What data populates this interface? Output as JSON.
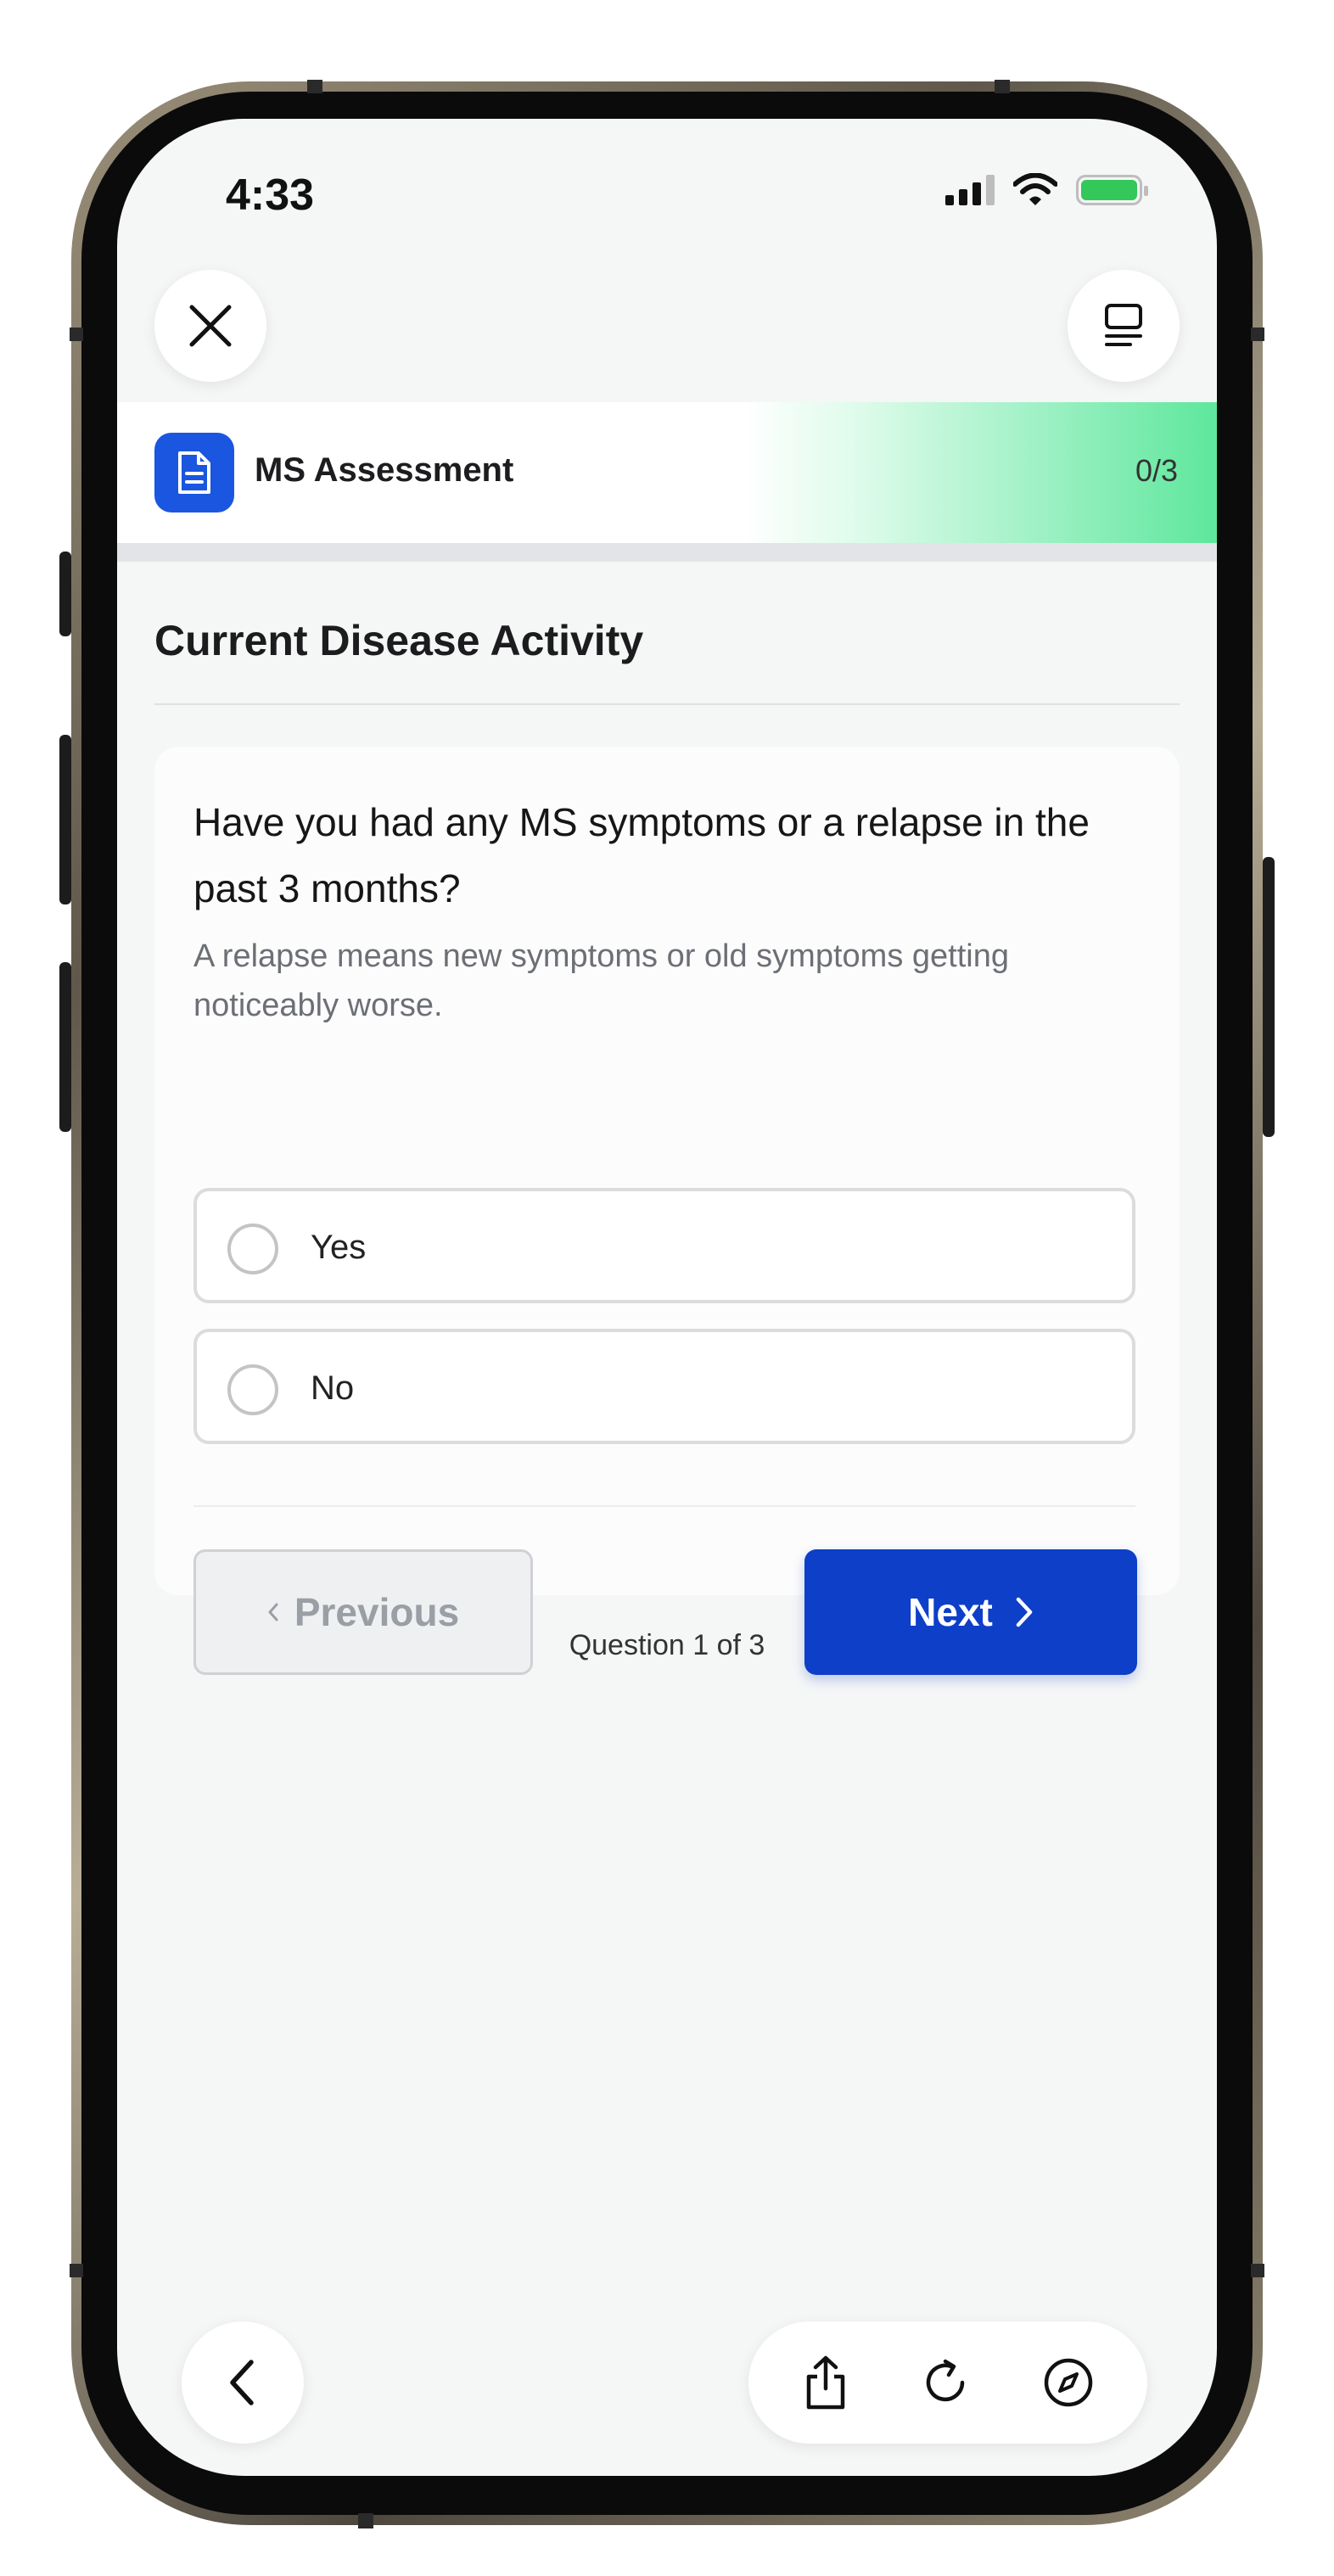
{
  "status_bar": {
    "time": "4:33"
  },
  "top_bar": {
    "close_icon": "close-icon",
    "menu_icon": "menu-icon"
  },
  "header": {
    "icon": "document-icon",
    "title": "MS Assessment",
    "count": "0/3",
    "accent_color": "#1a56e0",
    "progress_gradient_color": "#5ee79c"
  },
  "section": {
    "title": "Current Disease Activity"
  },
  "question_card": {
    "question": "Have you had any MS symptoms or a relapse in the past 3 months?",
    "hint": "A relapse means new symptoms or old symptoms getting noticeably worse.",
    "options": [
      {
        "label": "Yes",
        "selected": false
      },
      {
        "label": "No",
        "selected": false
      }
    ],
    "previous_label": "Previous",
    "next_label": "Next",
    "next_color": "#0d3fc8"
  },
  "progress_text": "Question 1 of 3",
  "browser_bar": {
    "icons": [
      "back-icon",
      "share-icon",
      "refresh-icon",
      "compass-icon"
    ]
  }
}
